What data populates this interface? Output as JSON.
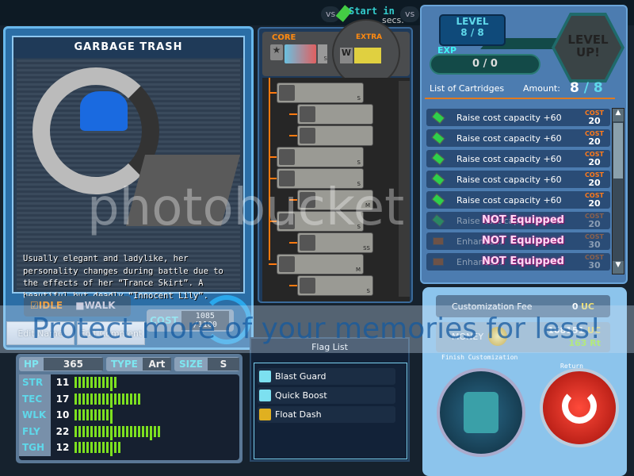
{
  "topbar": {
    "vs1": "vs",
    "status": "Start in",
    "secs": "secs.",
    "vs2": "vs"
  },
  "unit": {
    "name": "GARBAGE TRASH",
    "description": "Usually elegant and ladylike, her personality changes during battle due to the effects of her “Trance Skirt”. A beautiful but deadly “Innocent Lily”.",
    "idle_label": "IDLE",
    "walk_label": "WALK",
    "idle_checked": true,
    "walk_checked": false,
    "edit_name": "Edit Name",
    "edit_comment": "Edit Comment",
    "cost_label": "COST",
    "cost_value": "1085",
    "cost_max": "/1100"
  },
  "stats": {
    "hp_label": "HP",
    "hp": "365",
    "type_label": "TYPE",
    "type": "Art",
    "size_label": "SIZE",
    "size": "S",
    "rows": [
      {
        "k": "STR",
        "v": 11
      },
      {
        "k": "TEC",
        "v": 17
      },
      {
        "k": "WLK",
        "v": 10
      },
      {
        "k": "FLY",
        "v": 22
      },
      {
        "k": "TGH",
        "v": 12
      }
    ]
  },
  "parts": {
    "core_label": "CORE",
    "extra_label": "EXTRA",
    "extra_slot": "W",
    "tree": [
      {
        "depth": 0,
        "size": "S"
      },
      {
        "depth": 1,
        "size": ""
      },
      {
        "depth": 1,
        "size": ""
      },
      {
        "depth": 0,
        "size": "S"
      },
      {
        "depth": 0,
        "size": "S"
      },
      {
        "depth": 1,
        "size": "M"
      },
      {
        "depth": 0,
        "size": "S"
      },
      {
        "depth": 1,
        "size": "SS"
      },
      {
        "depth": 0,
        "size": "M"
      },
      {
        "depth": 1,
        "size": "S"
      }
    ],
    "core_size": "S"
  },
  "flags": {
    "title": "Flag List",
    "items": [
      "Blast Guard",
      "Quick Boost",
      "Float Dash"
    ]
  },
  "level": {
    "label": "LEVEL",
    "current": "8",
    "max": "/ 8",
    "exp_label": "EXP",
    "exp": "0 / 0",
    "levelup": "LEVEL UP!"
  },
  "cartridges": {
    "title": "List of Cartridges",
    "amount_label": "Amount:",
    "amount": "8",
    "amount_max": "8",
    "cost_label": "COST",
    "not_equipped": "NOT Equipped",
    "items": [
      {
        "name": "Raise cost capacity +60",
        "cost": "20",
        "equipped": true
      },
      {
        "name": "Raise cost capacity +60",
        "cost": "20",
        "equipped": true
      },
      {
        "name": "Raise cost capacity +60",
        "cost": "20",
        "equipped": true
      },
      {
        "name": "Raise cost capacity +60",
        "cost": "20",
        "equipped": true
      },
      {
        "name": "Raise cost capacity +60",
        "cost": "20",
        "equipped": true
      },
      {
        "name": "Raise cost capacity +60",
        "cost": "20",
        "equipped": false
      },
      {
        "name": "Enhance ...",
        "cost": "30",
        "equipped": false
      },
      {
        "name": "Enhance ...",
        "cost": "30",
        "equipped": false
      }
    ]
  },
  "shop": {
    "fee_label": "Customization Fee",
    "fee": "0",
    "uc": "UC",
    "money_label": "MONEY",
    "money": "168151",
    "rt": "163",
    "rt_unit": "Rt",
    "finish_label": "Finish Customization",
    "return_label": "Return"
  },
  "watermark": {
    "text": "Protect more of your memories for less!",
    "logo": "photobucket"
  },
  "colors": {
    "panel": "#4c7cb0",
    "stat_bar": "#7de020",
    "accent_orange": "#ff7a1a",
    "cyan": "#5fd8ea"
  }
}
